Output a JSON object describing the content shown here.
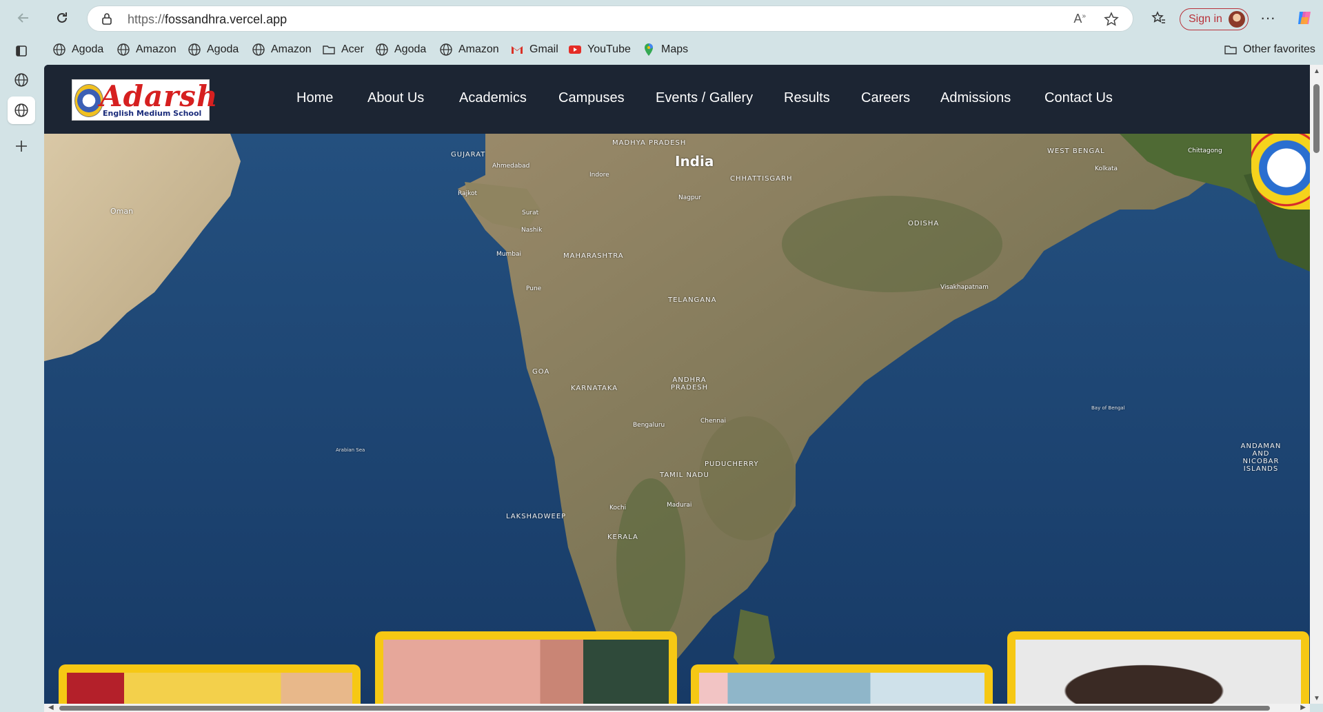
{
  "browser": {
    "url_scheme": "https://",
    "url_host": "fossandhra.vercel.app",
    "signin_label": "Sign in",
    "bookmarks": [
      {
        "label": "Agoda",
        "icon": "globe-icon"
      },
      {
        "label": "Amazon",
        "icon": "globe-icon"
      },
      {
        "label": "Agoda",
        "icon": "globe-icon"
      },
      {
        "label": "Amazon",
        "icon": "globe-icon"
      },
      {
        "label": "Acer",
        "icon": "folder-icon"
      },
      {
        "label": "Agoda",
        "icon": "globe-icon"
      },
      {
        "label": "Amazon",
        "icon": "globe-icon"
      },
      {
        "label": "Gmail",
        "icon": "gmail-icon"
      },
      {
        "label": "YouTube",
        "icon": "youtube-icon"
      },
      {
        "label": "Maps",
        "icon": "maps-icon"
      }
    ],
    "other_favorites": "Other favorites"
  },
  "site": {
    "logo_title": "Adarsh",
    "logo_subtitle": "English Medium School",
    "nav": [
      "Home",
      "About Us",
      "Academics",
      "Campuses",
      "Events / Gallery",
      "Results",
      "Careers",
      "Admissions",
      "Contact Us"
    ]
  },
  "map": {
    "country": "India",
    "labels": {
      "oman": "Oman",
      "gujarat": "GUJARAT",
      "madhya_pradesh": "MADHYA PRADESH",
      "chhattisgarh": "CHHATTISGARH",
      "west_bengal": "WEST BENGAL",
      "maharashtra": "MAHARASHTRA",
      "telangana": "TELANGANA",
      "odisha": "ODISHA",
      "goa": "GOA",
      "karnataka": "KARNATAKA",
      "andhra_pradesh": "ANDHRA PRADESH",
      "puducherry": "PUDUCHERRY",
      "tamil_nadu": "TAMIL NADU",
      "kerala": "KERALA",
      "lakshadweep": "LAKSHADWEEP",
      "andaman": "ANDAMAN AND NICOBAR ISLANDS",
      "arabian_sea": "Arabian Sea",
      "bay_of_bengal": "Bay of Bengal",
      "ahmedabad": "Ahmedabad",
      "rajkot": "Rajkot",
      "surat": "Surat",
      "indore": "Indore",
      "nagpur": "Nagpur",
      "kolkata": "Kolkata",
      "chittagong": "Chittagong",
      "nashik": "Nashik",
      "mumbai": "Mumbai",
      "pune": "Pune",
      "visakhapatnam": "Visakhapatnam",
      "bengaluru": "Bengaluru",
      "chennai": "Chennai",
      "kochi": "Kochi",
      "madurai": "Madurai"
    }
  },
  "colors": {
    "nav_bg": "#1c2533",
    "card_border": "#f6c814",
    "signin_accent": "#b8323a"
  }
}
